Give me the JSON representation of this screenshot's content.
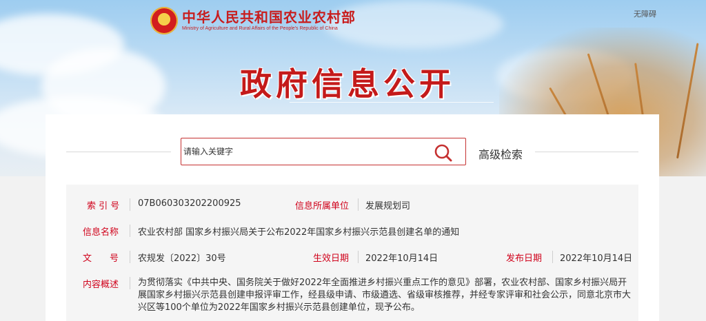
{
  "header": {
    "ministry_name_cn": "中华人民共和国农业农村部",
    "ministry_name_en": "Ministry of Agriculture and Rural Affairs of the People's Republic of China",
    "accessibility_label": "无障碍",
    "page_title": "政府信息公开"
  },
  "search": {
    "placeholder": "请输入关键字",
    "advanced_label": "高级检索",
    "button_icon": "search-icon"
  },
  "info": {
    "index_label": "索 引 号",
    "index_value": "07B060303202200925",
    "dept_label": "信息所属单位",
    "dept_value": "发展规划司",
    "name_label": "信息名称",
    "name_value": "农业农村部 国家乡村振兴局关于公布2022年国家乡村振兴示范县创建名单的通知",
    "doc_label": "文　　号",
    "doc_value": "农规发〔2022〕30号",
    "effective_label": "生效日期",
    "effective_value": "2022年10月14日",
    "publish_label": "发布日期",
    "publish_value": "2022年10月14日",
    "summary_label": "内容概述",
    "summary_value": "为贯彻落实《中共中央、国务院关于做好2022年全面推进乡村振兴重点工作的意见》部署，农业农村部、国家乡村振兴局开展国家乡村振兴示范县创建申报评审工作，经县级申请、市级遴选、省级审核推荐，并经专家评审和社会公示，同意北京市大兴区等100个单位为2022年国家乡村振兴示范县创建单位，现予公布。"
  },
  "colors": {
    "accent_red": "#c41a1a",
    "label_red": "#d0021b"
  }
}
